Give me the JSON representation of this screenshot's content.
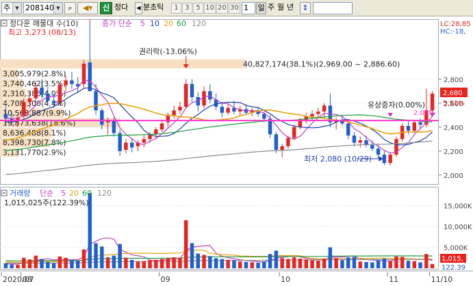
{
  "toolbar": {
    "market": "주",
    "code": "208140",
    "search_icon": "search-icon",
    "speaker_icon": "speaker-icon",
    "new_label": "신",
    "name": "정다",
    "tick_label": "분초틱",
    "periods": [
      "1",
      "3",
      "5",
      "10",
      "20",
      "30"
    ],
    "period_value": "1",
    "day_label": "일",
    "week_label": "주",
    "month_label": "월",
    "year_label": "년",
    "sort_icon": "up-down-icon"
  },
  "price_panel": {
    "title": "정다운 매물대 수(10)",
    "ma_label": "종가 단순",
    "ma_periods": [
      "5",
      "10",
      "20",
      "60",
      "120"
    ],
    "lc_label": "LC:28,85",
    "hc_label": "HC:-18,",
    "high_label": "최고 3,273 (08/13)",
    "low_label": "최저 2,080 (10/29)",
    "rights_label": "권리락(-13.06%)",
    "rights_issue_label": "유상증자(0.00%)",
    "current_price": "2,680",
    "current_change": "5.51%",
    "pct_label": "2.05%",
    "ticks": [
      {
        "value": 2800,
        "label": "2,800"
      },
      {
        "value": 2600,
        "label": "2,600"
      },
      {
        "value": 2400,
        "label": "2,400"
      },
      {
        "value": 2200,
        "label": "2,200"
      },
      {
        "value": 2000,
        "label": "2,000"
      }
    ],
    "profile": [
      {
        "label": "40,827,174(38.1%)(2,969.00 ~ 2,886.60)",
        "from": 2887,
        "to": 2969,
        "frac": 1.0
      },
      {
        "label": "3,005,979(2.8%)",
        "from": 2805,
        "to": 2887,
        "frac": 0.074
      },
      {
        "label": "3,740,462(3.5%)",
        "from": 2723,
        "to": 2805,
        "frac": 0.092
      },
      {
        "label": "2,310,386(4.0%)",
        "from": 2641,
        "to": 2723,
        "frac": 0.105
      },
      {
        "label": "4,708,300(4.4%)",
        "from": 2559,
        "to": 2641,
        "frac": 0.115
      },
      {
        "label": "10,568,887(9.9%)",
        "from": 2477,
        "to": 2559,
        "frac": 0.259
      },
      {
        "label": "19,873,638(18.6%)",
        "from": 2395,
        "to": 2477,
        "frac": 0.487
      },
      {
        "label": "8,636,488(8.1%)",
        "from": 2313,
        "to": 2395,
        "frac": 0.212
      },
      {
        "label": "8,398,730(7.8%)",
        "from": 2231,
        "to": 2313,
        "frac": 0.205
      },
      {
        "label": "3,131,770(2.9%)",
        "from": 2149,
        "to": 2231,
        "frac": 0.076
      }
    ],
    "resistance_price": 2455
  },
  "volume_panel": {
    "title": "거래량",
    "ma_label": "단순",
    "ma_periods": [
      "5",
      "20",
      "60",
      "120"
    ],
    "last_volume": "1,015,025주(122.39%)",
    "current_volume": "1,015,",
    "current_pct": "122.39",
    "ticks": [
      {
        "value": 15000000,
        "label": "15,000K"
      },
      {
        "value": 10000000,
        "label": "10,000K"
      },
      {
        "value": 5000000,
        "label": "5,000K"
      }
    ]
  },
  "x_axis": {
    "labels": [
      {
        "label": "2020/07",
        "idx": 0
      },
      {
        "label": "08",
        "idx": 3
      },
      {
        "label": "09",
        "idx": 26
      },
      {
        "label": "10",
        "idx": 46
      },
      {
        "label": "11",
        "idx": 64
      },
      {
        "label": "11/10",
        "idx": 71
      }
    ]
  },
  "colors": {
    "up": "#e8241f",
    "down": "#1f5fd0",
    "ma5": "#c040c0",
    "ma10": "#1b3fa8",
    "ma20": "#e6a00e",
    "ma60": "#1f9a3e",
    "ma120": "#8a8a8a",
    "resistance": "#ff33cc",
    "profile": "#f6dfc2"
  },
  "chart_data": {
    "type": "candlestick",
    "candles": [
      [
        2510,
        2570,
        2430,
        2470,
        1200000
      ],
      [
        2470,
        2520,
        2410,
        2450,
        900000
      ],
      [
        2450,
        2500,
        2400,
        2480,
        800000
      ],
      [
        2490,
        2640,
        2470,
        2610,
        2500000
      ],
      [
        2610,
        2700,
        2560,
        2640,
        2100000
      ],
      [
        2640,
        2780,
        2600,
        2730,
        3000000
      ],
      [
        2730,
        2800,
        2640,
        2670,
        2200000
      ],
      [
        2680,
        2740,
        2590,
        2620,
        1500000
      ],
      [
        2620,
        2680,
        2560,
        2600,
        1200000
      ],
      [
        2600,
        2780,
        2580,
        2750,
        2800000
      ],
      [
        2750,
        2830,
        2700,
        2790,
        2500000
      ],
      [
        2790,
        2860,
        2720,
        2760,
        2000000
      ],
      [
        2760,
        2820,
        2690,
        2740,
        1800000
      ],
      [
        2760,
        2960,
        2720,
        2930,
        4500000
      ],
      [
        2940,
        3273,
        2820,
        2700,
        18000000
      ],
      [
        2700,
        2760,
        2500,
        2540,
        6000000
      ],
      [
        2540,
        2560,
        2380,
        2420,
        5200000
      ],
      [
        2440,
        2480,
        2340,
        2460,
        2600000
      ],
      [
        2460,
        2480,
        2320,
        2350,
        3000000
      ],
      [
        2350,
        2380,
        2160,
        2200,
        5800000
      ],
      [
        2210,
        2300,
        2180,
        2270,
        2500000
      ],
      [
        2270,
        2310,
        2190,
        2230,
        2000000
      ],
      [
        2240,
        2290,
        2200,
        2270,
        1600000
      ],
      [
        2270,
        2330,
        2230,
        2300,
        1700000
      ],
      [
        2300,
        2360,
        2270,
        2340,
        1900000
      ],
      [
        2340,
        2400,
        2310,
        2380,
        2000000
      ],
      [
        2380,
        2460,
        2360,
        2430,
        2200000
      ],
      [
        2440,
        2520,
        2400,
        2500,
        2400000
      ],
      [
        2500,
        2580,
        2470,
        2540,
        2600000
      ],
      [
        2540,
        2610,
        2510,
        2570,
        2500000
      ],
      [
        2570,
        2800,
        2560,
        2760,
        11500000
      ],
      [
        2760,
        2800,
        2610,
        2650,
        6000000
      ],
      [
        2650,
        2690,
        2530,
        2580,
        3500000
      ],
      [
        2580,
        2740,
        2560,
        2700,
        3200000
      ],
      [
        2700,
        2760,
        2600,
        2630,
        2900000
      ],
      [
        2630,
        2680,
        2540,
        2570,
        2400000
      ],
      [
        2570,
        2610,
        2480,
        2520,
        2200000
      ],
      [
        2520,
        2600,
        2500,
        2560,
        2000000
      ],
      [
        2560,
        2620,
        2510,
        2530,
        1900000
      ],
      [
        2530,
        2580,
        2490,
        2550,
        1600000
      ],
      [
        2550,
        2590,
        2500,
        2520,
        1500000
      ],
      [
        2520,
        2560,
        2490,
        2540,
        1400000
      ],
      [
        2540,
        2570,
        2490,
        2510,
        1300000
      ],
      [
        2510,
        2530,
        2440,
        2470,
        1600000
      ],
      [
        2470,
        2500,
        2310,
        2340,
        3400000
      ],
      [
        2340,
        2360,
        2180,
        2210,
        4200000
      ],
      [
        2210,
        2260,
        2150,
        2240,
        2400000
      ],
      [
        2240,
        2330,
        2220,
        2310,
        2200000
      ],
      [
        2310,
        2420,
        2290,
        2400,
        2600000
      ],
      [
        2400,
        2480,
        2380,
        2460,
        2300000
      ],
      [
        2460,
        2520,
        2430,
        2490,
        2100000
      ],
      [
        2490,
        2540,
        2460,
        2510,
        1900000
      ],
      [
        2510,
        2560,
        2480,
        2530,
        1800000
      ],
      [
        2530,
        2600,
        2480,
        2580,
        2300000
      ],
      [
        2580,
        2680,
        2400,
        2440,
        5000000
      ],
      [
        2440,
        2480,
        2380,
        2460,
        2400000
      ],
      [
        2460,
        2500,
        2410,
        2430,
        1900000
      ],
      [
        2430,
        2460,
        2300,
        2330,
        2600000
      ],
      [
        2330,
        2360,
        2240,
        2270,
        2700000
      ],
      [
        2270,
        2320,
        2230,
        2290,
        1600000
      ],
      [
        2290,
        2330,
        2230,
        2250,
        1500000
      ],
      [
        2250,
        2290,
        2200,
        2220,
        1400000
      ],
      [
        2220,
        2250,
        2140,
        2170,
        1900000
      ],
      [
        2170,
        2200,
        2080,
        2100,
        2300000
      ],
      [
        2100,
        2190,
        2080,
        2170,
        1700000
      ],
      [
        2170,
        2320,
        2150,
        2300,
        2800000
      ],
      [
        2300,
        2430,
        2280,
        2410,
        2700000
      ],
      [
        2410,
        2450,
        2340,
        2370,
        1800000
      ],
      [
        2370,
        2460,
        2350,
        2440,
        1700000
      ],
      [
        2440,
        2470,
        2380,
        2420,
        1400000
      ],
      [
        2420,
        2720,
        2400,
        2540,
        3400000
      ],
      [
        2540,
        2700,
        2520,
        2680,
        1015025
      ]
    ],
    "markers": {
      "high_index": 14,
      "low_index": 63,
      "rights_index": 30,
      "rights_issue_index": 64
    }
  }
}
